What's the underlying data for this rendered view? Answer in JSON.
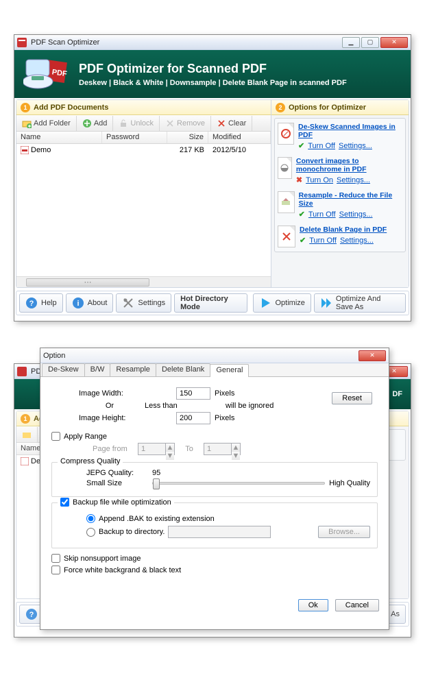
{
  "app": {
    "title": "PDF Scan Optimizer",
    "hero_title": "PDF Optimizer for Scanned PDF",
    "hero_sub": "Deskew | Black & White | Downsample | Delete Blank Page in scanned PDF"
  },
  "left": {
    "header": "Add PDF Documents",
    "toolbar": {
      "add_folder": "Add Folder",
      "add": "Add",
      "unlock": "Unlock",
      "remove": "Remove",
      "clear": "Clear"
    },
    "columns": {
      "name": "Name",
      "password": "Password",
      "size": "Size",
      "modified": "Modified"
    },
    "rows": [
      {
        "name": "Demo",
        "password": "",
        "size": "217 KB",
        "modified": "2012/5/10"
      }
    ]
  },
  "right": {
    "header": "Options for Optimizer",
    "items": [
      {
        "title": "De-Skew Scanned Images in PDF",
        "state": "on",
        "toggle": "Turn Off",
        "settings": "Settings..."
      },
      {
        "title": "Convert images to monochrome in PDF",
        "state": "off",
        "toggle": "Turn On",
        "settings": "Settings..."
      },
      {
        "title": "Resample - Reduce the File Size",
        "state": "on",
        "toggle": "Turn Off",
        "settings": "Settings..."
      },
      {
        "title": "Delete Blank Page in PDF",
        "state": "on",
        "toggle": "Turn Off",
        "settings": "Settings..."
      }
    ]
  },
  "bottom": {
    "help": "Help",
    "about": "About",
    "settings": "Settings",
    "hotdir": "Hot Directory Mode",
    "optimize": "Optimize",
    "optimize_save": "Optimize And Save As"
  },
  "dialog": {
    "title": "Option",
    "tabs": [
      "De-Skew",
      "B/W",
      "Resample",
      "Delete Blank",
      "General"
    ],
    "active_tab": "General",
    "sizes": {
      "image_width_label": "Image Width:",
      "or": "Or",
      "less_than": "Less than",
      "image_height_label": "Image Height:",
      "image_width": "150",
      "image_height": "200",
      "pixels": "Pixels",
      "ignored": "will be ignored",
      "reset": "Reset"
    },
    "range": {
      "apply_range": "Apply Range",
      "page_from": "Page from",
      "to": "To",
      "from_val": "1",
      "to_val": "1"
    },
    "compress": {
      "group": "Compress Quality",
      "jpeg_label": "JEPG Quality:",
      "jpeg_value": "95",
      "small": "Small Size",
      "high": "High Quality"
    },
    "backup": {
      "group": "Backup file while optimization",
      "append": "Append .BAK to existing  extension",
      "todir": "Backup to directory.",
      "browse": "Browse..."
    },
    "skip": "Skip nonsupport image",
    "force": "Force white backgrand & black text",
    "ok": "Ok",
    "cancel": "Cancel"
  }
}
